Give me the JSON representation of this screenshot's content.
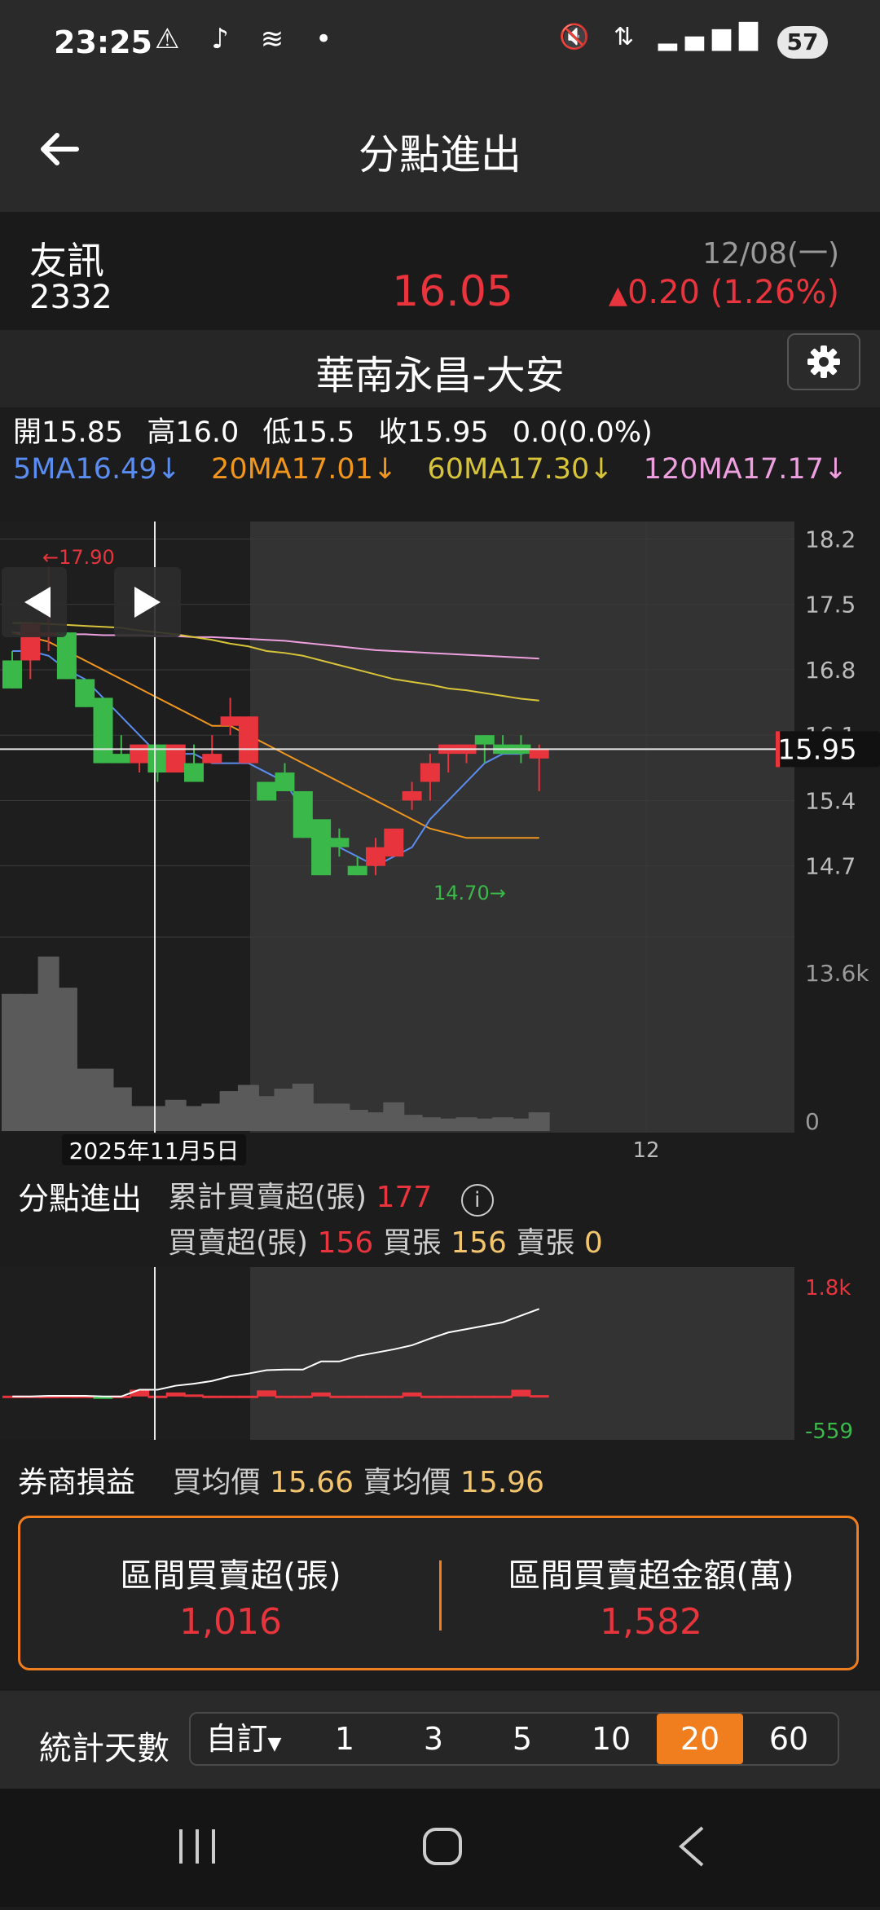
{
  "status": {
    "time": "23:25",
    "battery": "57"
  },
  "header": {
    "title": "分點進出"
  },
  "stock": {
    "name": "友訊",
    "code": "2332",
    "date": "12/08(一)",
    "price": "16.05",
    "change": "0.20 (1.26%)"
  },
  "broker": {
    "name": "華南永昌-大安"
  },
  "ohlc": {
    "open": "開15.85",
    "high": "高16.0",
    "low": "低15.5",
    "close": "收15.95",
    "chg": "0.0(0.0%)"
  },
  "ma": {
    "ma5": "5MA16.49↓",
    "ma20": "20MA17.01↓",
    "ma60": "60MA17.30↓",
    "ma120": "120MA17.17↓"
  },
  "colors": {
    "up": "#e8343c",
    "down": "#3ab84a",
    "ma5": "#5b8df0",
    "ma20": "#f0961e",
    "ma60": "#d8c43a",
    "ma120": "#ee9fe0",
    "accent": "#f07d1e"
  },
  "chart_data": [
    {
      "type": "candlestick",
      "title": "",
      "y_ticks": [
        "18.2",
        "17.5",
        "16.8",
        "16.1",
        "15.4",
        "14.7"
      ],
      "ylim": [
        14.2,
        18.3
      ],
      "volume_ticks": [
        "13.6k",
        "0"
      ],
      "x_labels": [
        "2025年11月5日",
        "12"
      ],
      "max_label": "←17.90",
      "min_label": "14.70→",
      "last_price_label": "15.95",
      "candles": [
        {
          "o": 16.9,
          "h": 17.0,
          "l": 16.6,
          "c": 16.6
        },
        {
          "o": 16.9,
          "h": 17.3,
          "l": 16.7,
          "c": 17.3
        },
        {
          "o": 17.2,
          "h": 17.9,
          "l": 17.0,
          "c": 17.2
        },
        {
          "o": 17.2,
          "h": 17.2,
          "l": 16.7,
          "c": 16.7
        },
        {
          "o": 16.7,
          "h": 16.7,
          "l": 16.4,
          "c": 16.4
        },
        {
          "o": 16.5,
          "h": 16.5,
          "l": 15.8,
          "c": 15.8
        },
        {
          "o": 15.9,
          "h": 16.1,
          "l": 15.8,
          "c": 15.8
        },
        {
          "o": 15.8,
          "h": 16.0,
          "l": 15.7,
          "c": 16.0
        },
        {
          "o": 16.0,
          "h": 16.0,
          "l": 15.6,
          "c": 15.7
        },
        {
          "o": 15.7,
          "h": 16.0,
          "l": 15.7,
          "c": 16.0
        },
        {
          "o": 15.8,
          "h": 16.0,
          "l": 15.6,
          "c": 15.6
        },
        {
          "o": 15.8,
          "h": 16.1,
          "l": 15.8,
          "c": 15.9
        },
        {
          "o": 16.2,
          "h": 16.5,
          "l": 16.1,
          "c": 16.3
        },
        {
          "o": 15.8,
          "h": 16.3,
          "l": 15.8,
          "c": 16.3
        },
        {
          "o": 15.6,
          "h": 15.6,
          "l": 15.4,
          "c": 15.4
        },
        {
          "o": 15.7,
          "h": 15.8,
          "l": 15.5,
          "c": 15.5
        },
        {
          "o": 15.5,
          "h": 15.5,
          "l": 15.0,
          "c": 15.0
        },
        {
          "o": 15.2,
          "h": 15.2,
          "l": 14.6,
          "c": 14.6
        },
        {
          "o": 15.0,
          "h": 15.1,
          "l": 14.8,
          "c": 14.9
        },
        {
          "o": 14.7,
          "h": 14.8,
          "l": 14.6,
          "c": 14.6
        },
        {
          "o": 14.7,
          "h": 15.0,
          "l": 14.6,
          "c": 14.9
        },
        {
          "o": 14.8,
          "h": 15.1,
          "l": 14.8,
          "c": 15.1
        },
        {
          "o": 15.4,
          "h": 15.6,
          "l": 15.3,
          "c": 15.5
        },
        {
          "o": 15.6,
          "h": 15.9,
          "l": 15.4,
          "c": 15.8
        },
        {
          "o": 15.9,
          "h": 16.0,
          "l": 15.7,
          "c": 16.0
        },
        {
          "o": 15.9,
          "h": 16.0,
          "l": 15.8,
          "c": 16.0
        },
        {
          "o": 16.1,
          "h": 16.1,
          "l": 15.8,
          "c": 16.0
        },
        {
          "o": 16.0,
          "h": 16.1,
          "l": 15.9,
          "c": 15.9
        },
        {
          "o": 16.0,
          "h": 16.1,
          "l": 15.8,
          "c": 15.9
        },
        {
          "o": 15.85,
          "h": 16.0,
          "l": 15.5,
          "c": 15.95
        }
      ],
      "ma5": [
        17.0,
        17.0,
        16.95,
        16.8,
        16.7,
        16.5,
        16.3,
        16.1,
        15.9,
        15.9,
        15.9,
        15.8,
        15.8,
        15.8,
        15.7,
        15.6,
        15.3,
        15.1,
        14.9,
        14.8,
        14.7,
        14.8,
        14.9,
        15.2,
        15.4,
        15.6,
        15.8,
        15.9,
        15.9,
        15.95
      ],
      "ma20": [
        17.2,
        17.15,
        17.1,
        17.0,
        16.9,
        16.8,
        16.7,
        16.6,
        16.5,
        16.4,
        16.3,
        16.2,
        16.2,
        16.1,
        16.0,
        15.9,
        15.8,
        15.7,
        15.6,
        15.5,
        15.4,
        15.3,
        15.2,
        15.1,
        15.05,
        15.0,
        15.0,
        15.0,
        15.0,
        15.0
      ],
      "ma60": [
        17.3,
        17.3,
        17.29,
        17.28,
        17.27,
        17.26,
        17.25,
        17.22,
        17.2,
        17.18,
        17.15,
        17.12,
        17.08,
        17.05,
        17.0,
        16.98,
        16.95,
        16.9,
        16.85,
        16.8,
        16.75,
        16.7,
        16.67,
        16.64,
        16.6,
        16.58,
        16.55,
        16.52,
        16.49,
        16.47
      ],
      "ma120": [
        17.2,
        17.19,
        17.19,
        17.18,
        17.18,
        17.17,
        17.17,
        17.17,
        17.16,
        17.16,
        17.15,
        17.15,
        17.14,
        17.13,
        17.12,
        17.11,
        17.09,
        17.07,
        17.05,
        17.03,
        17.01,
        17.0,
        16.99,
        16.98,
        16.97,
        16.96,
        16.95,
        16.94,
        16.93,
        16.92
      ],
      "volume": [
        11000,
        11000,
        14000,
        11500,
        5000,
        5000,
        3500,
        2000,
        2000,
        2500,
        2000,
        2200,
        3200,
        3700,
        2800,
        3400,
        3800,
        2200,
        2200,
        1700,
        1500,
        2300,
        1300,
        1100,
        1000,
        1100,
        1000,
        1100,
        1000,
        1500
      ]
    },
    {
      "type": "bar",
      "title": "分點進出",
      "y_ticks": [
        "1.8k",
        "-559"
      ],
      "ylim": [
        -559,
        1800
      ],
      "net": [
        0,
        0,
        10,
        0,
        0,
        -10,
        0,
        100,
        0,
        60,
        30,
        0,
        0,
        0,
        90,
        0,
        0,
        60,
        0,
        0,
        0,
        0,
        60,
        0,
        0,
        0,
        0,
        0,
        100,
        20
      ],
      "cumulative": [
        0,
        0,
        10,
        10,
        10,
        0,
        0,
        100,
        100,
        160,
        190,
        230,
        300,
        340,
        390,
        400,
        400,
        520,
        520,
        600,
        650,
        700,
        760,
        860,
        950,
        1000,
        1050,
        1100,
        1200,
        1300
      ]
    }
  ],
  "flow": {
    "section_label": "分點進出",
    "cum_label": "累計買賣超(張)",
    "cum_value": "177",
    "net_label": "買賣超(張)",
    "net_value": "156",
    "buy_label": "買張",
    "buy_value": "156",
    "sell_label": "賣張",
    "sell_value": "0"
  },
  "pnl": {
    "label": "券商損益",
    "buy_avg_label": "買均價",
    "buy_avg": "15.66",
    "sell_avg_label": "賣均價",
    "sell_avg": "15.96"
  },
  "summary": {
    "net_label": "區間買賣超(張)",
    "net_value": "1,016",
    "amount_label": "區間買賣超金額(萬)",
    "amount_value": "1,582"
  },
  "days": {
    "label": "統計天數",
    "custom": "自訂",
    "options": [
      "1",
      "3",
      "5",
      "10",
      "20",
      "60"
    ],
    "active": "20"
  }
}
